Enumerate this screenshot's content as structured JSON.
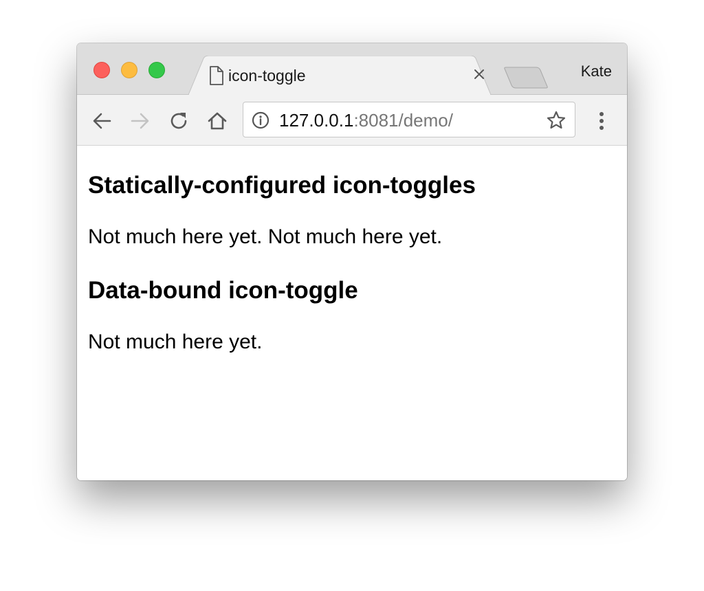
{
  "browser": {
    "tab": {
      "title": "icon-toggle",
      "icon": "document-icon"
    },
    "profile_name": "Kate",
    "address_bar": {
      "host": "127.0.0.1",
      "rest": ":8081/demo/",
      "security_icon": "info-icon"
    },
    "toolbar_icons": [
      "back-arrow-icon",
      "forward-arrow-icon",
      "reload-icon",
      "home-icon",
      "star-icon",
      "menu-dots-icon"
    ],
    "traffic_light_colors": {
      "close": "#fc605c",
      "minimize": "#fdbc40",
      "maximize": "#34c84a"
    }
  },
  "page": {
    "sections": [
      {
        "heading": "Statically-configured icon-toggles",
        "text": "Not much here yet. Not much here yet."
      },
      {
        "heading": "Data-bound icon-toggle",
        "text": "Not much here yet."
      }
    ]
  }
}
